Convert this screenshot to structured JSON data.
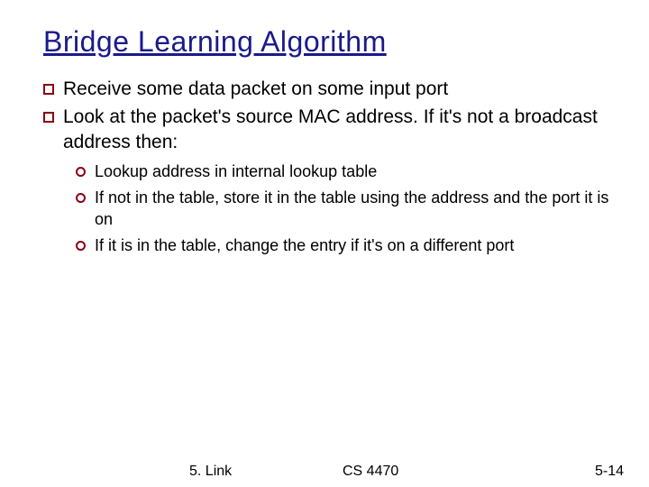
{
  "title": "Bridge Learning Algorithm",
  "bullets": [
    "Receive some data packet on some input port",
    "Look at the packet's source MAC address.  If it's not a broadcast address then:"
  ],
  "subbullets": [
    "Lookup address in internal lookup table",
    "If not in the table, store it in the table using the address and the port it is on",
    "If it is in the table, change the entry if it's on a different port"
  ],
  "footer": {
    "section": "5.  Link",
    "course": "CS 4470",
    "page": "5-14"
  }
}
